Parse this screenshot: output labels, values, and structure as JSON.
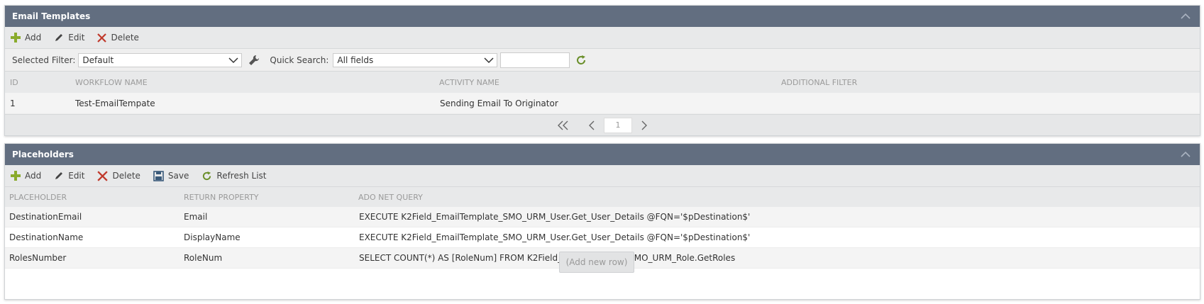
{
  "email_templates": {
    "title": "Email Templates",
    "toolbar": {
      "add": "Add",
      "edit": "Edit",
      "delete": "Delete"
    },
    "filter": {
      "selected_filter_label": "Selected Filter:",
      "selected_filter_value": "Default",
      "quick_search_label": "Quick Search:",
      "quick_search_field": "All fields",
      "quick_search_text": ""
    },
    "columns": [
      "ID",
      "WORKFLOW NAME",
      "ACTIVITY NAME",
      "ADDITIONAL FILTER"
    ],
    "rows": [
      {
        "id": "1",
        "workflow": "Test-EmailTempate",
        "activity": "Sending Email To Originator",
        "filter": ""
      }
    ],
    "pager": {
      "page": "1"
    }
  },
  "placeholders": {
    "title": "Placeholders",
    "toolbar": {
      "add": "Add",
      "edit": "Edit",
      "delete": "Delete",
      "save": "Save",
      "refresh": "Refresh List"
    },
    "columns": [
      "PLACEHOLDER",
      "RETURN PROPERTY",
      "ADO NET QUERY"
    ],
    "rows": [
      {
        "placeholder": "DestinationEmail",
        "ret": "Email",
        "query": "EXECUTE K2Field_EmailTemplate_SMO_URM_User.Get_User_Details @FQN='$pDestination$'"
      },
      {
        "placeholder": "DestinationName",
        "ret": "DisplayName",
        "query": "EXECUTE K2Field_EmailTemplate_SMO_URM_User.Get_User_Details @FQN='$pDestination$'"
      },
      {
        "placeholder": "RolesNumber",
        "ret": "RoleNum",
        "query": "SELECT COUNT(*) AS [RoleNum] FROM K2Field_EmailTemplate_SMO_URM_Role.GetRoles"
      }
    ],
    "add_new_row": "(Add new row)"
  },
  "colors": {
    "header": "#626e80",
    "add_icon": "#8aab2c",
    "delete_icon": "#c0392b",
    "refresh_icon": "#6a8f2a"
  }
}
